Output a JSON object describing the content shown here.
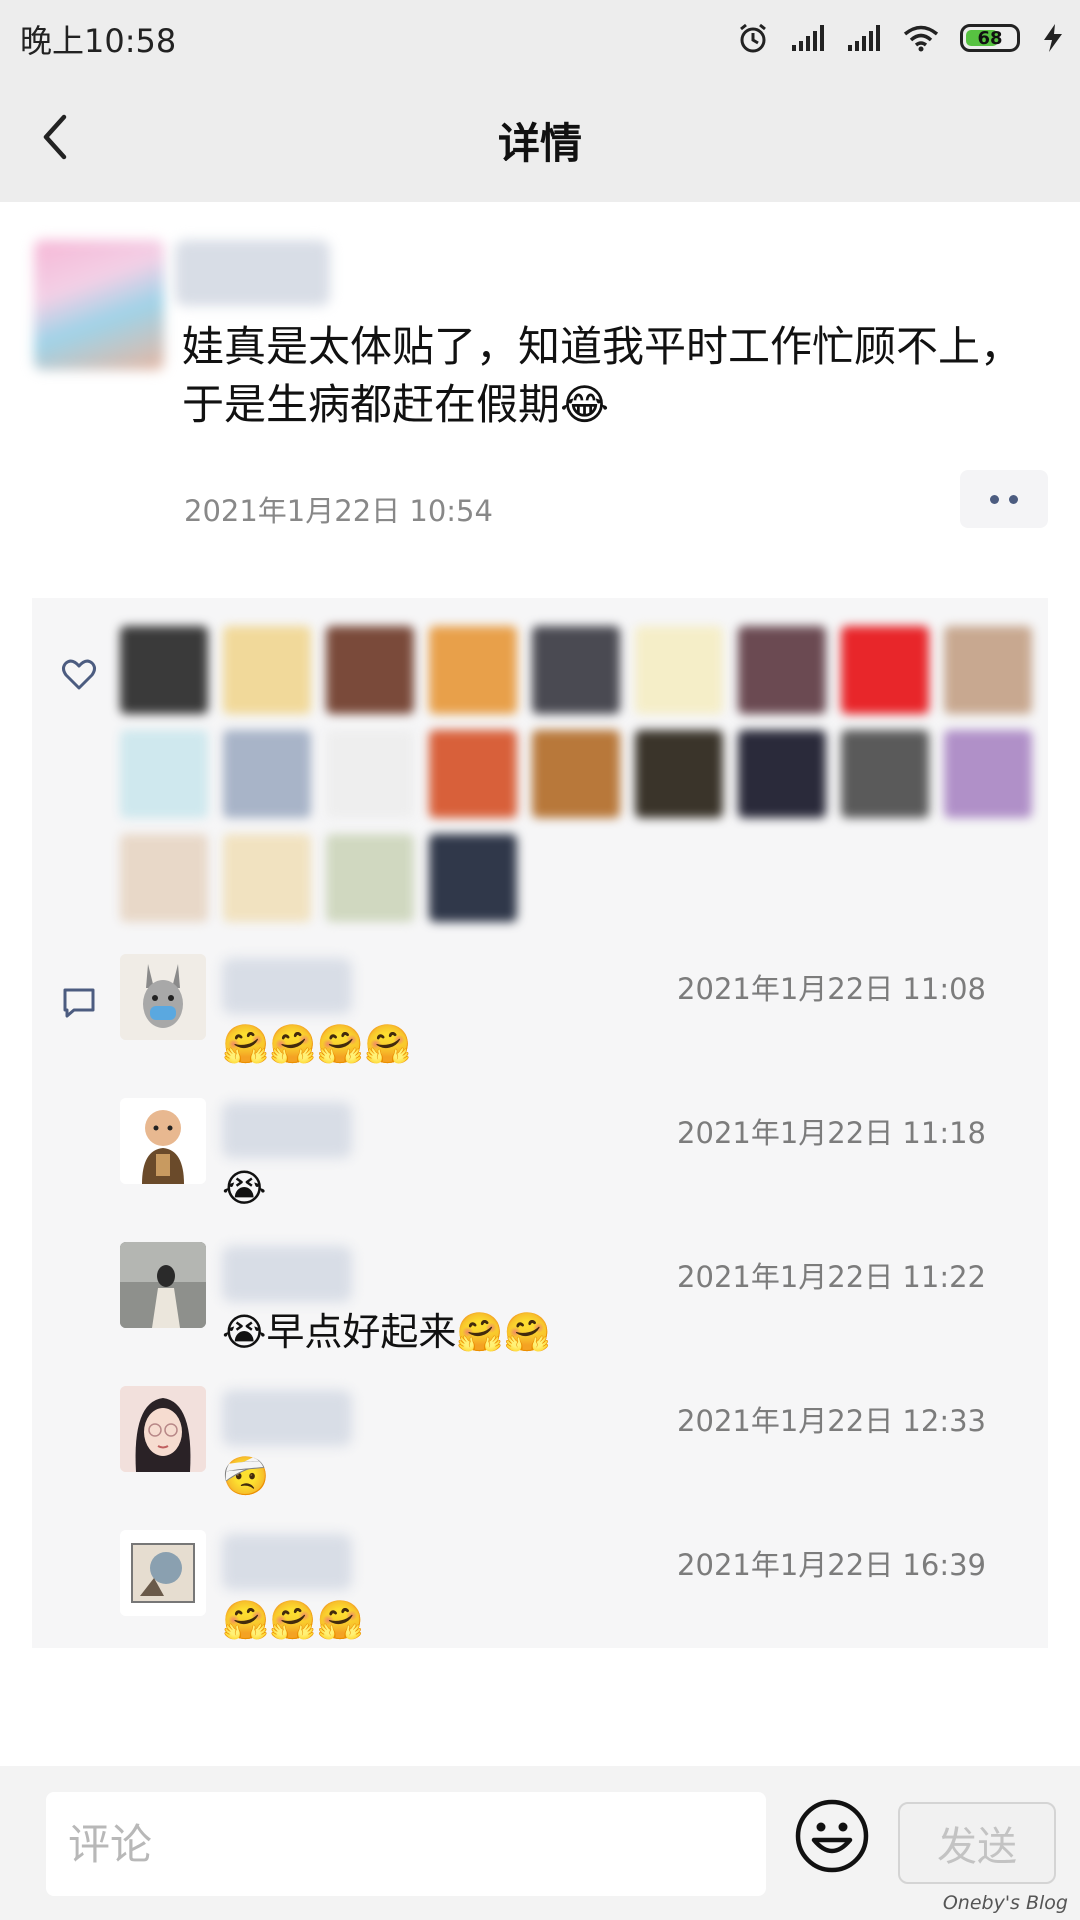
{
  "status_bar": {
    "time": "晚上10:58",
    "battery": "68",
    "icons": [
      "alarm-icon",
      "signal-icon",
      "signal-icon",
      "wifi-icon",
      "battery-icon",
      "charging-icon"
    ]
  },
  "nav": {
    "title": "详情",
    "back_icon": "chevron-left-icon"
  },
  "post": {
    "text": "娃真是太体贴了，知道我平时工作忙顾不上，于是生病都赶在假期😂",
    "time": "2021年1月22日 10:54",
    "more_icon": "more-dots-icon"
  },
  "likes": {
    "icon": "heart-icon",
    "avatars": [
      "#3a3a3a",
      "#f1d99a",
      "#7a4a3a",
      "#e8a04a",
      "#4a4a52",
      "#f5eec8",
      "#6b4a52",
      "#e8262a",
      "#c8a890",
      "#cfe8ee",
      "#a8b4c8",
      "#eeeeee",
      "#d8603a",
      "#b8783a",
      "#3a342a",
      "#2a2a3a",
      "#5a5a5a",
      "#b090c8",
      "#e8d8c8",
      "#f1e2c0",
      "#d0d8c0",
      "#30384a"
    ]
  },
  "comments": {
    "icon": "comment-bubble-icon",
    "items": [
      {
        "time": "2021年1月22日 11:08",
        "text": "🤗🤗🤗🤗"
      },
      {
        "time": "2021年1月22日 11:18",
        "text": "😭"
      },
      {
        "time": "2021年1月22日 11:22",
        "text": "😭早点好起来🤗🤗"
      },
      {
        "time": "2021年1月22日 12:33",
        "text": "🤕"
      },
      {
        "time": "2021年1月22日 16:39",
        "text": "🤗🤗🤗"
      }
    ]
  },
  "composer": {
    "placeholder": "评论",
    "send_label": "发送",
    "emoji_icon": "smiley-face-icon"
  },
  "watermark": "Oneby's Blog",
  "colors": {
    "background": "#ffffff",
    "header": "#ededed",
    "panel": "#f6f6f7",
    "link": "#4c5c80"
  }
}
